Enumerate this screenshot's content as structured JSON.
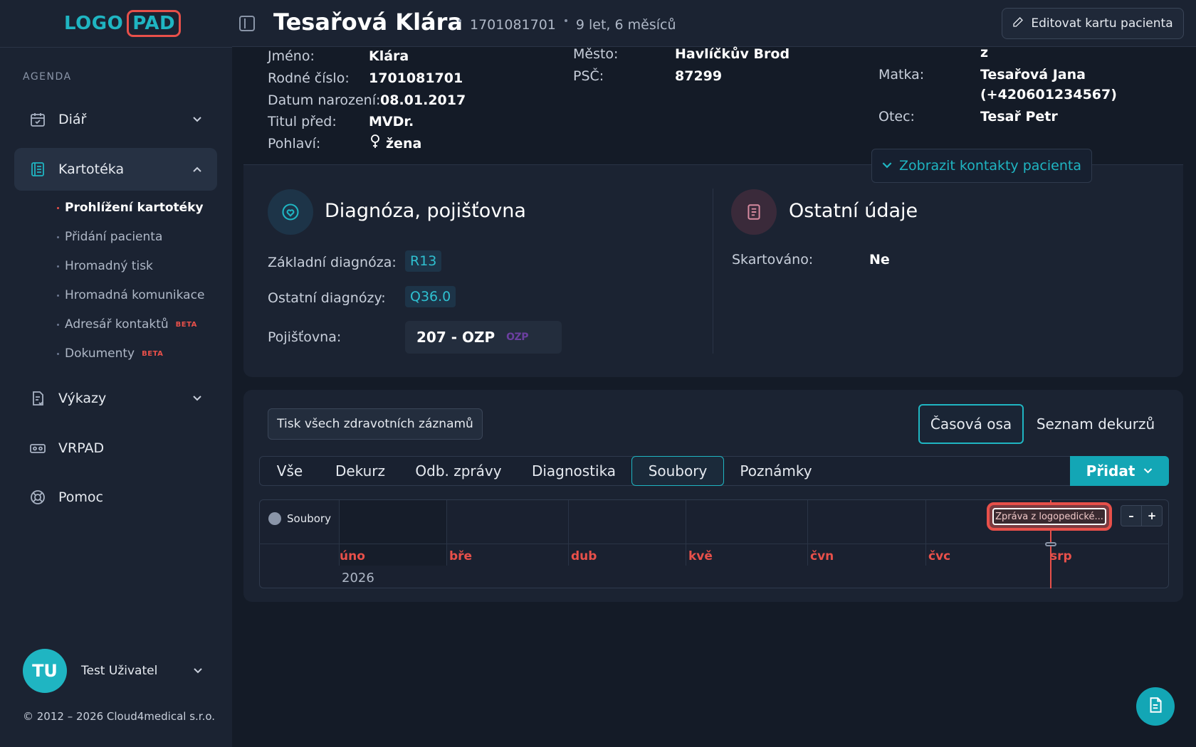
{
  "app": {
    "logo_part1": "LOGO",
    "logo_part2": "PAD",
    "accent": "#1fb5c2",
    "brand_red": "#e8504a"
  },
  "sidebar": {
    "section_label": "AGENDA",
    "items": [
      {
        "label": "Diář",
        "icon": "calendar-icon"
      },
      {
        "label": "Kartotéka",
        "icon": "records-icon"
      },
      {
        "label": "Výkazy",
        "icon": "report-icon"
      },
      {
        "label": "VRPAD",
        "icon": "vr-icon"
      },
      {
        "label": "Pomoc",
        "icon": "lifebuoy-icon"
      }
    ],
    "sub_items": [
      {
        "label": "Prohlížení kartotéky"
      },
      {
        "label": "Přidání pacienta"
      },
      {
        "label": "Hromadný tisk"
      },
      {
        "label": "Hromadná komunikace"
      },
      {
        "label": "Adresář kontaktů",
        "badge": "BETA"
      },
      {
        "label": "Dokumenty",
        "badge": "BETA"
      }
    ],
    "user": {
      "initials": "TU",
      "name": "Test Uživatel"
    },
    "copyright": "© 2012 – 2026 Cloud4medical s.r.o."
  },
  "header": {
    "patient_name": "Tesařová Klára",
    "birth_number": "1701081701",
    "age": "9 let, 6 měsíců",
    "edit_button": "Editovat kartu pacienta"
  },
  "patient": {
    "first_name_label": "Jméno:",
    "first_name": "Klára",
    "birth_number_label": "Rodné číslo:",
    "birth_number": "1701081701",
    "dob_label": "Datum narození:",
    "dob": "08.01.2017",
    "title_label": "Titul před:",
    "title": "MVDr.",
    "sex_label": "Pohlaví:",
    "sex": "žena",
    "city_label": "Město:",
    "city": "Havlíčkův Brod",
    "zip_label": "PSČ:",
    "zip": "87299",
    "top_right_value": "z",
    "mother_label": "Matka:",
    "mother": "Tesařová Jana",
    "mother_phone": "(+420601234567)",
    "father_label": "Otec:",
    "father": "Tesař Petr",
    "contacts_button": "Zobrazit kontakty pacienta"
  },
  "diagnosis": {
    "title": "Diagnóza, pojišťovna",
    "basic_label": "Základní diagnóza:",
    "basic": "R13",
    "other_label": "Ostatní diagnózy:",
    "other": "Q36.0",
    "insurance_label": "Pojišťovna:",
    "insurance": "207 - OZP",
    "insurance_logo": "OZP"
  },
  "other_info": {
    "title": "Ostatní údaje",
    "shredded_label": "Skartováno:",
    "shredded": "Ne"
  },
  "records": {
    "print_button": "Tisk všech zdravotních záznamů",
    "views": [
      "Časová osa",
      "Seznam dekurzů"
    ],
    "tabs": [
      "Vše",
      "Dekurz",
      "Odb. zprávy",
      "Diagnostika",
      "Soubory",
      "Poznámky"
    ],
    "add_button": "Přidat"
  },
  "timeline": {
    "row_label": "Soubory",
    "months": [
      "úno",
      "bře",
      "dub",
      "kvě",
      "čvn",
      "čvc",
      "srp"
    ],
    "year": "2026",
    "event": "Zpráva z logopedické...",
    "zoom_out": "–",
    "zoom_in": "+"
  }
}
